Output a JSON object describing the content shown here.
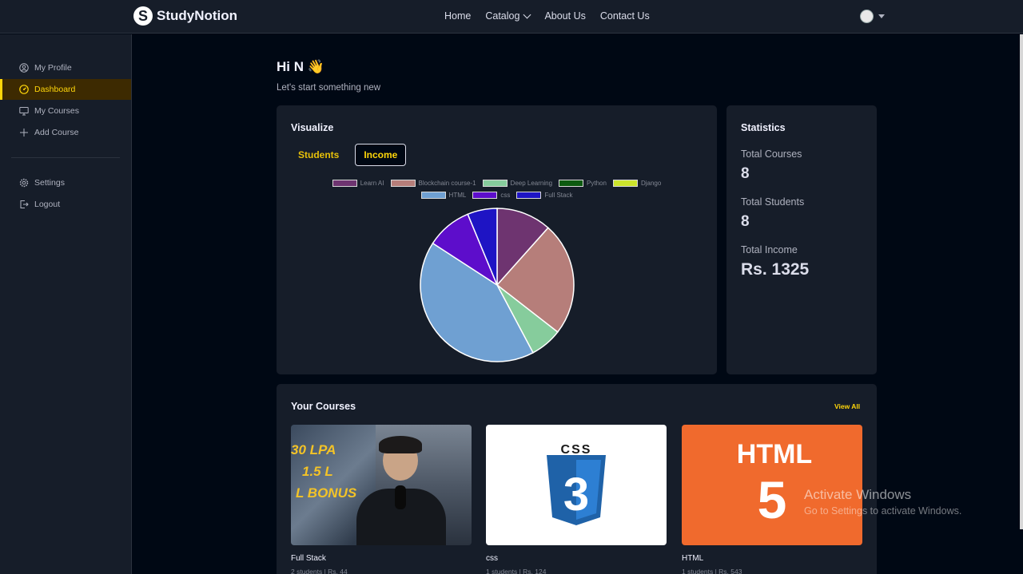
{
  "nav": {
    "logo_mark": "S",
    "logo_text": "StudyNotion",
    "links": [
      "Home",
      "Catalog",
      "About Us",
      "Contact Us"
    ]
  },
  "sidebar": {
    "items": [
      {
        "label": "My Profile",
        "icon": "user-circle-icon"
      },
      {
        "label": "Dashboard",
        "icon": "gauge-icon",
        "active": true
      },
      {
        "label": "My Courses",
        "icon": "monitor-icon"
      },
      {
        "label": "Add Course",
        "icon": "plus-icon"
      }
    ],
    "bottom_items": [
      {
        "label": "Settings",
        "icon": "gear-icon"
      },
      {
        "label": "Logout",
        "icon": "logout-icon"
      }
    ]
  },
  "greeting": {
    "title": "Hi N 👋",
    "subtitle": "Let's start something new"
  },
  "visualize": {
    "title": "Visualize",
    "tabs": [
      {
        "label": "Students",
        "active": false
      },
      {
        "label": "Income",
        "active": true
      }
    ]
  },
  "chart_data": {
    "type": "pie",
    "categories": [
      "Learn AI",
      "Blockchain course-1",
      "Deep Learning",
      "Python",
      "Django",
      "HTML",
      "css",
      "Full Stack"
    ],
    "values": [
      150,
      310,
      87,
      0,
      0,
      543,
      124,
      81
    ],
    "colors": [
      "#6E3470",
      "#B67E7A",
      "#86CC9C",
      "#0D5A10",
      "#CCE42C",
      "#6FA0D2",
      "#5D0DCB",
      "#1E14C4"
    ],
    "legend_placement": "top"
  },
  "statistics": {
    "title": "Statistics",
    "items": [
      {
        "label": "Total Courses",
        "value": "8"
      },
      {
        "label": "Total Students",
        "value": "8"
      },
      {
        "label": "Total Income",
        "value": "Rs. 1325"
      }
    ]
  },
  "courses": {
    "title": "Your Courses",
    "view_all": "View All",
    "items": [
      {
        "name": "Full Stack",
        "meta": "2 students  |  Rs. 44",
        "thumb_text": [
          "30 LPA",
          "1.5 L",
          "L BONUS"
        ]
      },
      {
        "name": "css",
        "meta": "1 students  |  Rs. 124",
        "thumb_text": [
          "CSS",
          "3"
        ]
      },
      {
        "name": "HTML",
        "meta": "1 students  |  Rs. 543",
        "thumb_text": [
          "HTML",
          "5"
        ]
      }
    ]
  },
  "watermark": {
    "line1": "Activate Windows",
    "line2": "Go to Settings to activate Windows."
  }
}
